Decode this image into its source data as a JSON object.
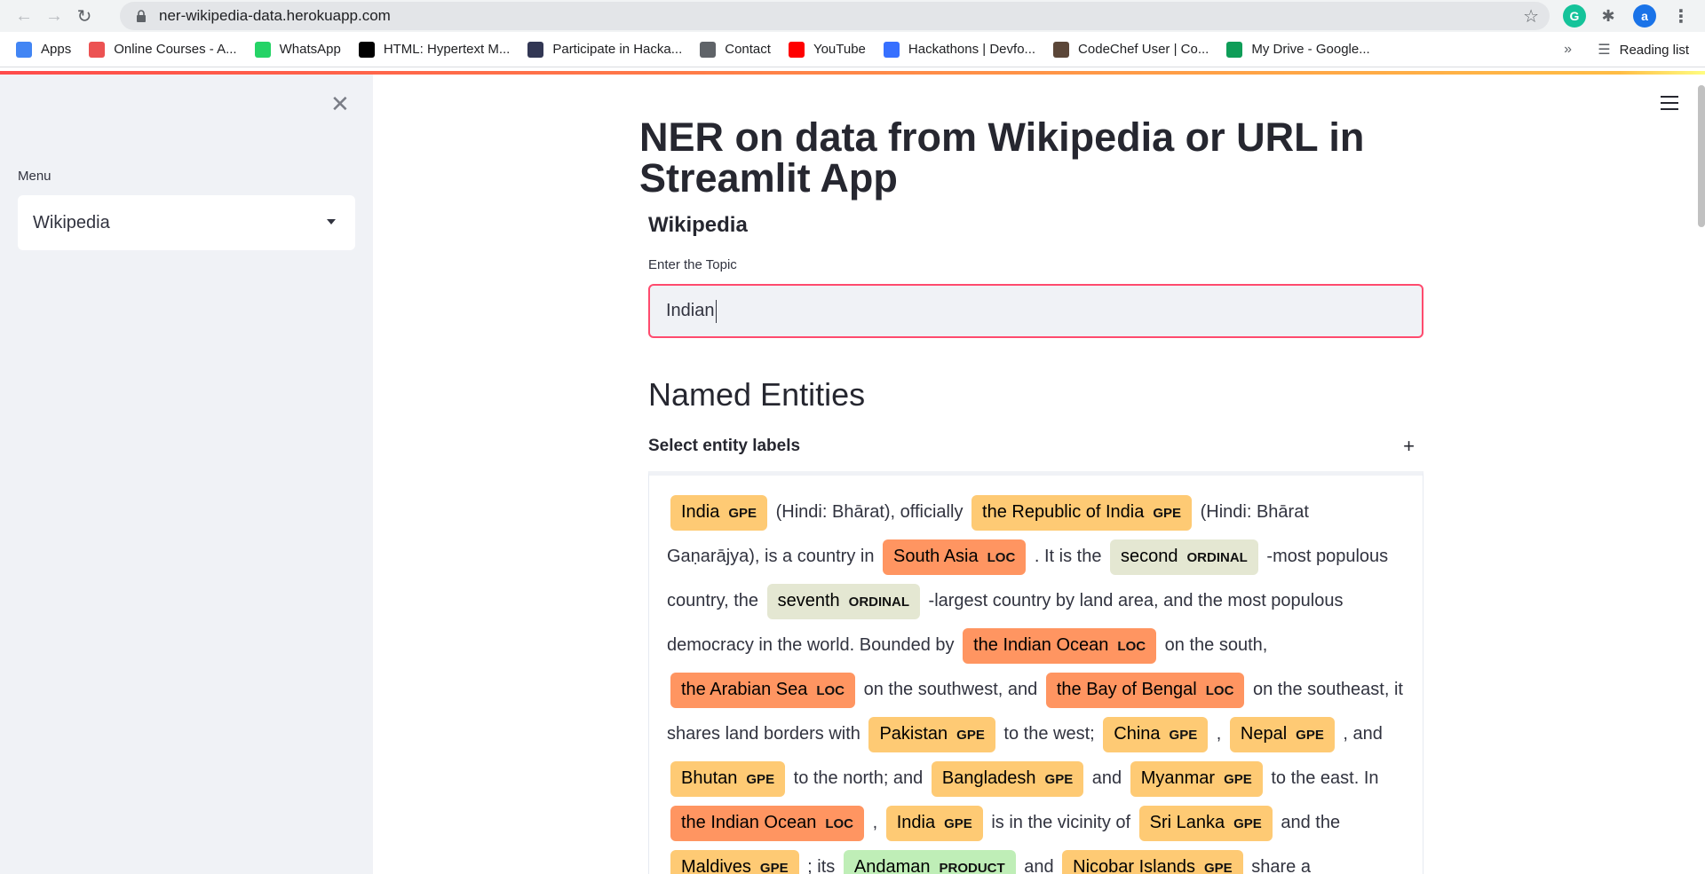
{
  "browser": {
    "url": "ner-wikipedia-data.herokuapp.com",
    "profile_initial": "a",
    "bookmarks": [
      {
        "label": "Apps",
        "icon": "apps-grid-icon",
        "color": "#4285f4"
      },
      {
        "label": "Online Courses - A...",
        "icon": "udemy-icon",
        "color": "#ec5252"
      },
      {
        "label": "WhatsApp",
        "icon": "whatsapp-icon",
        "color": "#25d366"
      },
      {
        "label": "HTML: Hypertext M...",
        "icon": "mdn-icon",
        "color": "#000000"
      },
      {
        "label": "Participate in Hacka...",
        "icon": "hackerearth-icon",
        "color": "#323754"
      },
      {
        "label": "Contact",
        "icon": "globe-icon",
        "color": "#5f6368"
      },
      {
        "label": "YouTube",
        "icon": "youtube-icon",
        "color": "#ff0000"
      },
      {
        "label": "Hackathons | Devfo...",
        "icon": "devfolio-icon",
        "color": "#3770ff"
      },
      {
        "label": "CodeChef User | Co...",
        "icon": "codechef-icon",
        "color": "#5b4638"
      },
      {
        "label": "My Drive - Google...",
        "icon": "google-drive-icon",
        "color": "#0f9d58"
      }
    ],
    "more": "»",
    "reading_list": "Reading list"
  },
  "sidebar": {
    "menu_label": "Menu",
    "selected": "Wikipedia"
  },
  "main": {
    "title": "NER on data from Wikipedia or URL in Streamlit App",
    "subheader": "Wikipedia",
    "input_label": "Enter the Topic",
    "input_value": "Indian",
    "section_title": "Named Entities",
    "expander_label": "Select entity labels",
    "expander_icon": "+"
  },
  "ner_text": [
    {
      "t": "India",
      "e": "GPE"
    },
    {
      "t": "(Hindi: Bhārat), officially"
    },
    {
      "t": "the Republic of India",
      "e": "GPE"
    },
    {
      "t": "(Hindi: Bhārat Gaṇarājya), is a country in"
    },
    {
      "t": "South Asia",
      "e": "LOC"
    },
    {
      "t": ". It is the"
    },
    {
      "t": "second",
      "e": "ORDINAL"
    },
    {
      "t": "-most populous country, the"
    },
    {
      "t": "seventh",
      "e": "ORDINAL"
    },
    {
      "t": "-largest country by land area, and the most populous democracy in the world. Bounded by"
    },
    {
      "t": "the Indian Ocean",
      "e": "LOC"
    },
    {
      "t": "on the south,"
    },
    {
      "t": "the Arabian Sea",
      "e": "LOC"
    },
    {
      "t": "on the southwest, and"
    },
    {
      "t": "the Bay of Bengal",
      "e": "LOC"
    },
    {
      "t": "on the southeast, it shares land borders with"
    },
    {
      "t": "Pakistan",
      "e": "GPE"
    },
    {
      "t": "to the west;"
    },
    {
      "t": "China",
      "e": "GPE"
    },
    {
      "t": ","
    },
    {
      "t": "Nepal",
      "e": "GPE"
    },
    {
      "t": ", and"
    },
    {
      "t": "Bhutan",
      "e": "GPE"
    },
    {
      "t": "to the north; and"
    },
    {
      "t": "Bangladesh",
      "e": "GPE"
    },
    {
      "t": "and"
    },
    {
      "t": "Myanmar",
      "e": "GPE"
    },
    {
      "t": "to the east. In"
    },
    {
      "t": "the Indian Ocean",
      "e": "LOC"
    },
    {
      "t": ","
    },
    {
      "t": "India",
      "e": "GPE"
    },
    {
      "t": "is in the vicinity of"
    },
    {
      "t": "Sri Lanka",
      "e": "GPE"
    },
    {
      "t": "and the"
    },
    {
      "t": "Maldives",
      "e": "GPE"
    },
    {
      "t": "; its"
    },
    {
      "t": "Andaman",
      "e": "PRODUCT"
    },
    {
      "t": "and"
    },
    {
      "t": "Nicobar Islands",
      "e": "GPE"
    },
    {
      "t": "share a"
    }
  ]
}
